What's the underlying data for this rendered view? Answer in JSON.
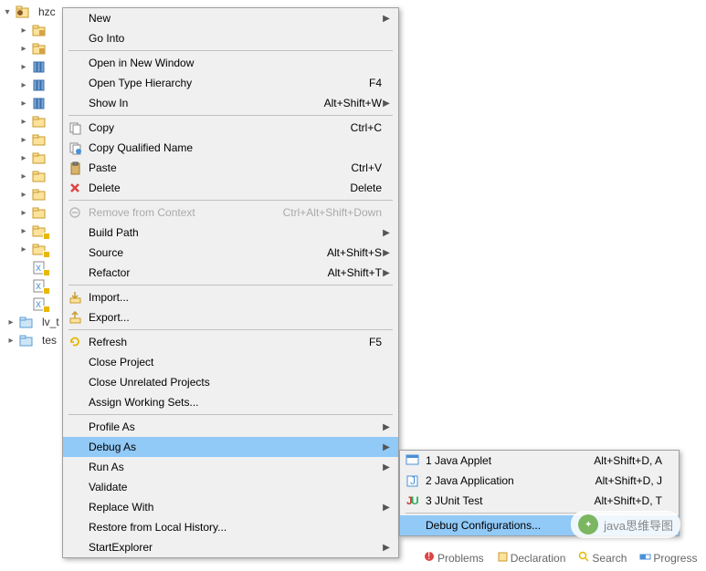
{
  "tree": {
    "root": "hzc",
    "items": [
      "",
      "",
      "",
      "",
      "",
      "",
      "",
      "",
      "",
      "",
      "",
      "",
      "",
      "",
      "",
      ""
    ],
    "lv": "lv_t",
    "tes": "tes"
  },
  "menu1": [
    {
      "label": "New",
      "key": "",
      "sub": true
    },
    {
      "label": "Go Into"
    },
    {
      "sep": true
    },
    {
      "label": "Open in New Window"
    },
    {
      "label": "Open Type Hierarchy",
      "key": "F4"
    },
    {
      "label": "Show In",
      "key": "Alt+Shift+W",
      "sub": true
    },
    {
      "sep": true
    },
    {
      "label": "Copy",
      "key": "Ctrl+C",
      "icon": "copy"
    },
    {
      "label": "Copy Qualified Name",
      "icon": "copyq"
    },
    {
      "label": "Paste",
      "key": "Ctrl+V",
      "icon": "paste"
    },
    {
      "label": "Delete",
      "key": "Delete",
      "icon": "delete"
    },
    {
      "sep": true
    },
    {
      "label": "Remove from Context",
      "key": "Ctrl+Alt+Shift+Down",
      "icon": "remctx",
      "disabled": true
    },
    {
      "label": "Build Path",
      "sub": true
    },
    {
      "label": "Source",
      "key": "Alt+Shift+S",
      "sub": true
    },
    {
      "label": "Refactor",
      "key": "Alt+Shift+T",
      "sub": true
    },
    {
      "sep": true
    },
    {
      "label": "Import...",
      "icon": "import"
    },
    {
      "label": "Export...",
      "icon": "export"
    },
    {
      "sep": true
    },
    {
      "label": "Refresh",
      "key": "F5",
      "icon": "refresh"
    },
    {
      "label": "Close Project"
    },
    {
      "label": "Close Unrelated Projects"
    },
    {
      "label": "Assign Working Sets..."
    },
    {
      "sep": true
    },
    {
      "label": "Profile As",
      "sub": true
    },
    {
      "label": "Debug As",
      "sub": true,
      "hl": true
    },
    {
      "label": "Run As",
      "sub": true
    },
    {
      "label": "Validate"
    },
    {
      "label": "Replace With",
      "sub": true
    },
    {
      "label": "Restore from Local History..."
    },
    {
      "label": "StartExplorer",
      "sub": true
    }
  ],
  "menu2": [
    {
      "label": "1 Java Applet",
      "key": "Alt+Shift+D, A",
      "icon": "applet"
    },
    {
      "label": "2 Java Application",
      "key": "Alt+Shift+D, J",
      "icon": "javaapp"
    },
    {
      "label": "3 JUnit Test",
      "key": "Alt+Shift+D, T",
      "icon": "junit"
    },
    {
      "sep": true
    },
    {
      "label": "Debug Configurations...",
      "hl": true
    }
  ],
  "tabs": [
    {
      "label": "Problems",
      "icon": "problems"
    },
    {
      "label": "Declaration",
      "icon": "decl"
    },
    {
      "label": "Search",
      "icon": "search"
    },
    {
      "label": "Progress",
      "icon": "progress"
    }
  ],
  "watermark": "java思维导图"
}
